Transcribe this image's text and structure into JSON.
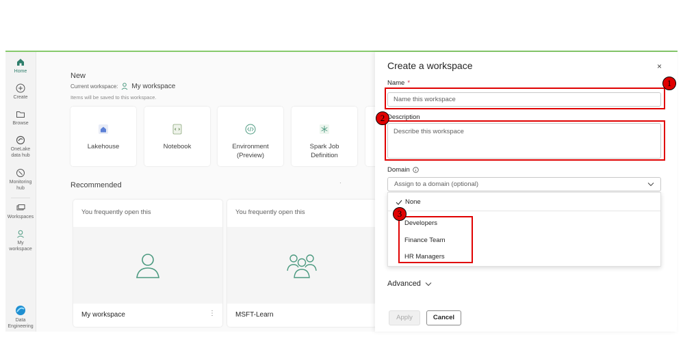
{
  "rail": {
    "home": "Home",
    "create": "Create",
    "browse": "Browse",
    "onelake": [
      "OneLake",
      "data hub"
    ],
    "monitoring": [
      "Monitoring",
      "hub"
    ],
    "workspaces": "Workspaces",
    "myworkspace": [
      "My",
      "workspace"
    ],
    "experience": [
      "Data",
      "Engineering"
    ]
  },
  "main": {
    "new_title": "New",
    "current_workspace_label": "Current workspace:",
    "current_workspace_name": "My workspace",
    "items_saved_note": "Items will be saved to this workspace.",
    "cards": [
      {
        "line1": "Lakehouse",
        "line2": "",
        "icon": "lakehouse-icon"
      },
      {
        "line1": "Notebook",
        "line2": "",
        "icon": "notebook-icon"
      },
      {
        "line1": "Environment",
        "line2": "(Preview)",
        "icon": "environment-icon"
      },
      {
        "line1": "Spark Job",
        "line2": "Definition",
        "icon": "spark-job-icon"
      }
    ],
    "recommended_title": "Recommended",
    "recommended": [
      {
        "caption": "You frequently open this",
        "name": "My workspace",
        "more": "⋮"
      },
      {
        "caption": "You frequently open this",
        "name": "MSFT-Learn"
      }
    ]
  },
  "panel": {
    "title": "Create a workspace",
    "close": "×",
    "name_label": "Name",
    "required_mark": "*",
    "name_placeholder": "Name this workspace",
    "description_label": "Description",
    "description_placeholder": "Describe this workspace",
    "domain_label": "Domain",
    "domain_placeholder": "Assign to a domain (optional)",
    "domain_options": {
      "selected": "None",
      "items": [
        "Developers",
        "Finance Team",
        "HR Managers"
      ]
    },
    "advanced_label": "Advanced",
    "apply_label": "Apply",
    "cancel_label": "Cancel"
  },
  "annotations": [
    "1",
    "2",
    "3"
  ],
  "colors": {
    "accent": "#2e7d6b",
    "annotation": "#e00000",
    "top_border": "#86c96b"
  }
}
